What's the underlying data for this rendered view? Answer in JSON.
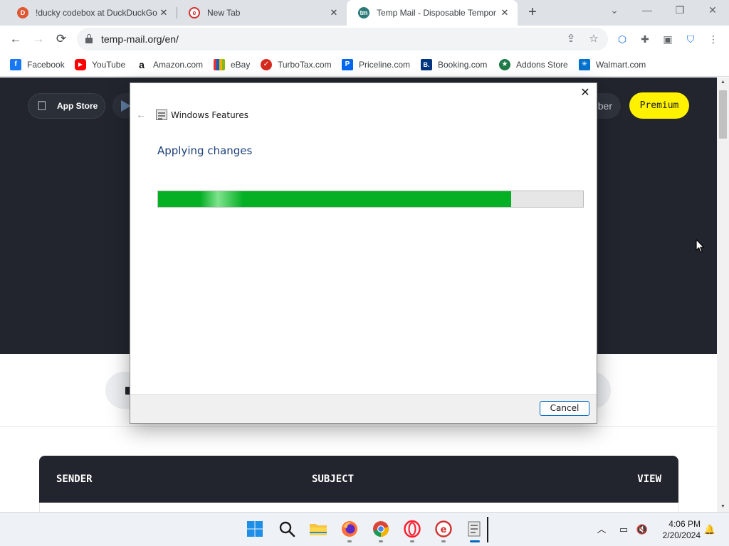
{
  "browser": {
    "tabs": [
      {
        "title": "!ducky codebox at DuckDuckGo",
        "favicon": "duckduckgo-icon",
        "color": "#de5833",
        "active": false
      },
      {
        "title": "New Tab",
        "favicon": "opera-gx-icon",
        "color": "#d32f2f",
        "active": false
      },
      {
        "title": "Temp Mail - Disposable Tempor",
        "favicon": "tempmail-icon",
        "color": "#2b7a78",
        "active": true
      }
    ],
    "new_tab_label": "+",
    "url": "temp-mail.org/en/",
    "bookmarks": [
      {
        "label": "Facebook",
        "icon": "facebook-icon",
        "glyph": "f",
        "color": "#1877f2"
      },
      {
        "label": "YouTube",
        "icon": "youtube-icon",
        "glyph": "▶",
        "color": "#ff0000"
      },
      {
        "label": "Amazon.com",
        "icon": "amazon-icon",
        "glyph": "a",
        "color": "#ffffff"
      },
      {
        "label": "eBay",
        "icon": "ebay-icon",
        "glyph": "",
        "color": "#e53238"
      },
      {
        "label": "TurboTax.com",
        "icon": "turbotax-icon",
        "glyph": "✓",
        "color": "#d52b1e"
      },
      {
        "label": "Priceline.com",
        "icon": "priceline-icon",
        "glyph": "P",
        "color": "#0068ef"
      },
      {
        "label": "Booking.com",
        "icon": "booking-icon",
        "glyph": "B.",
        "color": "#003580"
      },
      {
        "label": "Addons Store",
        "icon": "addons-store-icon",
        "glyph": "★",
        "color": "#1e7a46"
      },
      {
        "label": "Walmart.com",
        "icon": "walmart-icon",
        "glyph": "✳",
        "color": "#0071ce"
      }
    ]
  },
  "webpage": {
    "app_store_label": "App Store",
    "partial_button_label": "ber",
    "premium_label": "Premium",
    "inbox_columns": [
      "SENDER",
      "SUBJECT",
      "VIEW"
    ]
  },
  "dialog": {
    "window_title": "Windows Features",
    "heading": "Applying changes",
    "progress_fraction": 0.83,
    "progress_color": "#06b025",
    "cancel_label": "Cancel"
  },
  "taskbar": {
    "time": "4:06 PM",
    "date": "2/20/2024",
    "apps": [
      "start-icon",
      "search-icon",
      "file-explorer-icon",
      "firefox-icon",
      "chrome-icon",
      "opera-icon",
      "opera-gx-icon",
      "windows-features-icon"
    ]
  }
}
